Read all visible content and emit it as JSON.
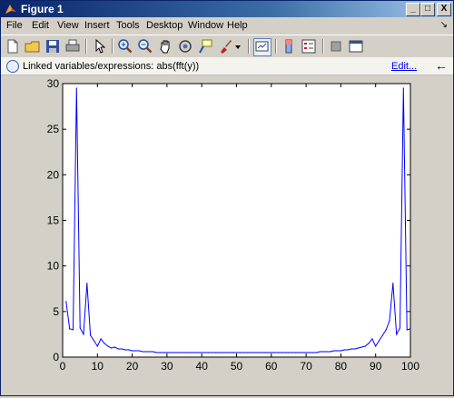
{
  "window": {
    "title": "Figure 1",
    "controls": [
      "_",
      "□",
      "X"
    ]
  },
  "menubar": {
    "items": [
      "File",
      "Edit",
      "View",
      "Insert",
      "Tools",
      "Desktop",
      "Window",
      "Help"
    ],
    "overflow_arrow": "↘"
  },
  "toolbar": {
    "icons": [
      "new-figure-icon",
      "open-file-icon",
      "save-icon",
      "print-icon",
      "select-arrow-icon",
      "zoom-in-icon",
      "zoom-out-icon",
      "pan-hand-icon",
      "rotate-3d-icon",
      "data-cursor-icon",
      "brush-icon",
      "brush-dropdown-icon",
      "link-plot-icon",
      "insert-colorbar-icon",
      "insert-legend-icon",
      "hide-plot-tools-icon",
      "show-plot-tools-icon"
    ]
  },
  "linkbar": {
    "text": "Linked variables/expressions: abs(fft(y))",
    "edit_label": "Edit...",
    "back_glyph": "←"
  },
  "chart_data": {
    "type": "line",
    "title": "",
    "xlabel": "",
    "ylabel": "",
    "xlim": [
      0,
      100
    ],
    "ylim": [
      0,
      30
    ],
    "xticks": [
      0,
      10,
      20,
      30,
      40,
      50,
      60,
      70,
      80,
      90,
      100
    ],
    "yticks": [
      0,
      5,
      10,
      15,
      20,
      25,
      30
    ],
    "grid": false,
    "color": "#0000ff",
    "series": [
      {
        "x": [
          1,
          2,
          3,
          4,
          5,
          6,
          7,
          8,
          9,
          10,
          11,
          12,
          13,
          14,
          15,
          16,
          17,
          18,
          19,
          20,
          21,
          22,
          23,
          24,
          25,
          26,
          27,
          28,
          29,
          30,
          31,
          32,
          33,
          34,
          35,
          36,
          37,
          38,
          39,
          40,
          41,
          42,
          43,
          44,
          45,
          46,
          47,
          48,
          49,
          50,
          51,
          52,
          53,
          54,
          55,
          56,
          57,
          58,
          59,
          60,
          61,
          62,
          63,
          64,
          65,
          66,
          67,
          68,
          69,
          70,
          71,
          72,
          73,
          74,
          75,
          76,
          77,
          78,
          79,
          80,
          81,
          82,
          83,
          84,
          85,
          86,
          87,
          88,
          89,
          90,
          91,
          92,
          93,
          94,
          95,
          96,
          97,
          98,
          99,
          100
        ],
        "values": [
          6.1,
          3.1,
          3.0,
          29.5,
          3.2,
          2.5,
          8.1,
          2.4,
          1.8,
          1.2,
          2.0,
          1.5,
          1.2,
          1.0,
          1.1,
          0.9,
          0.9,
          0.8,
          0.8,
          0.7,
          0.7,
          0.7,
          0.6,
          0.6,
          0.6,
          0.6,
          0.5,
          0.5,
          0.5,
          0.5,
          0.5,
          0.5,
          0.5,
          0.5,
          0.5,
          0.5,
          0.5,
          0.5,
          0.5,
          0.5,
          0.5,
          0.5,
          0.5,
          0.5,
          0.5,
          0.5,
          0.5,
          0.5,
          0.5,
          0.5,
          0.5,
          0.5,
          0.5,
          0.5,
          0.5,
          0.5,
          0.5,
          0.5,
          0.5,
          0.5,
          0.5,
          0.5,
          0.5,
          0.5,
          0.5,
          0.5,
          0.5,
          0.5,
          0.5,
          0.5,
          0.5,
          0.5,
          0.5,
          0.6,
          0.6,
          0.6,
          0.6,
          0.7,
          0.7,
          0.7,
          0.8,
          0.8,
          0.9,
          0.9,
          1.0,
          1.1,
          1.2,
          1.5,
          2.0,
          1.2,
          1.8,
          2.4,
          3.0,
          4.0,
          8.1,
          2.5,
          3.2,
          29.5,
          3.0,
          3.1
        ]
      }
    ]
  }
}
